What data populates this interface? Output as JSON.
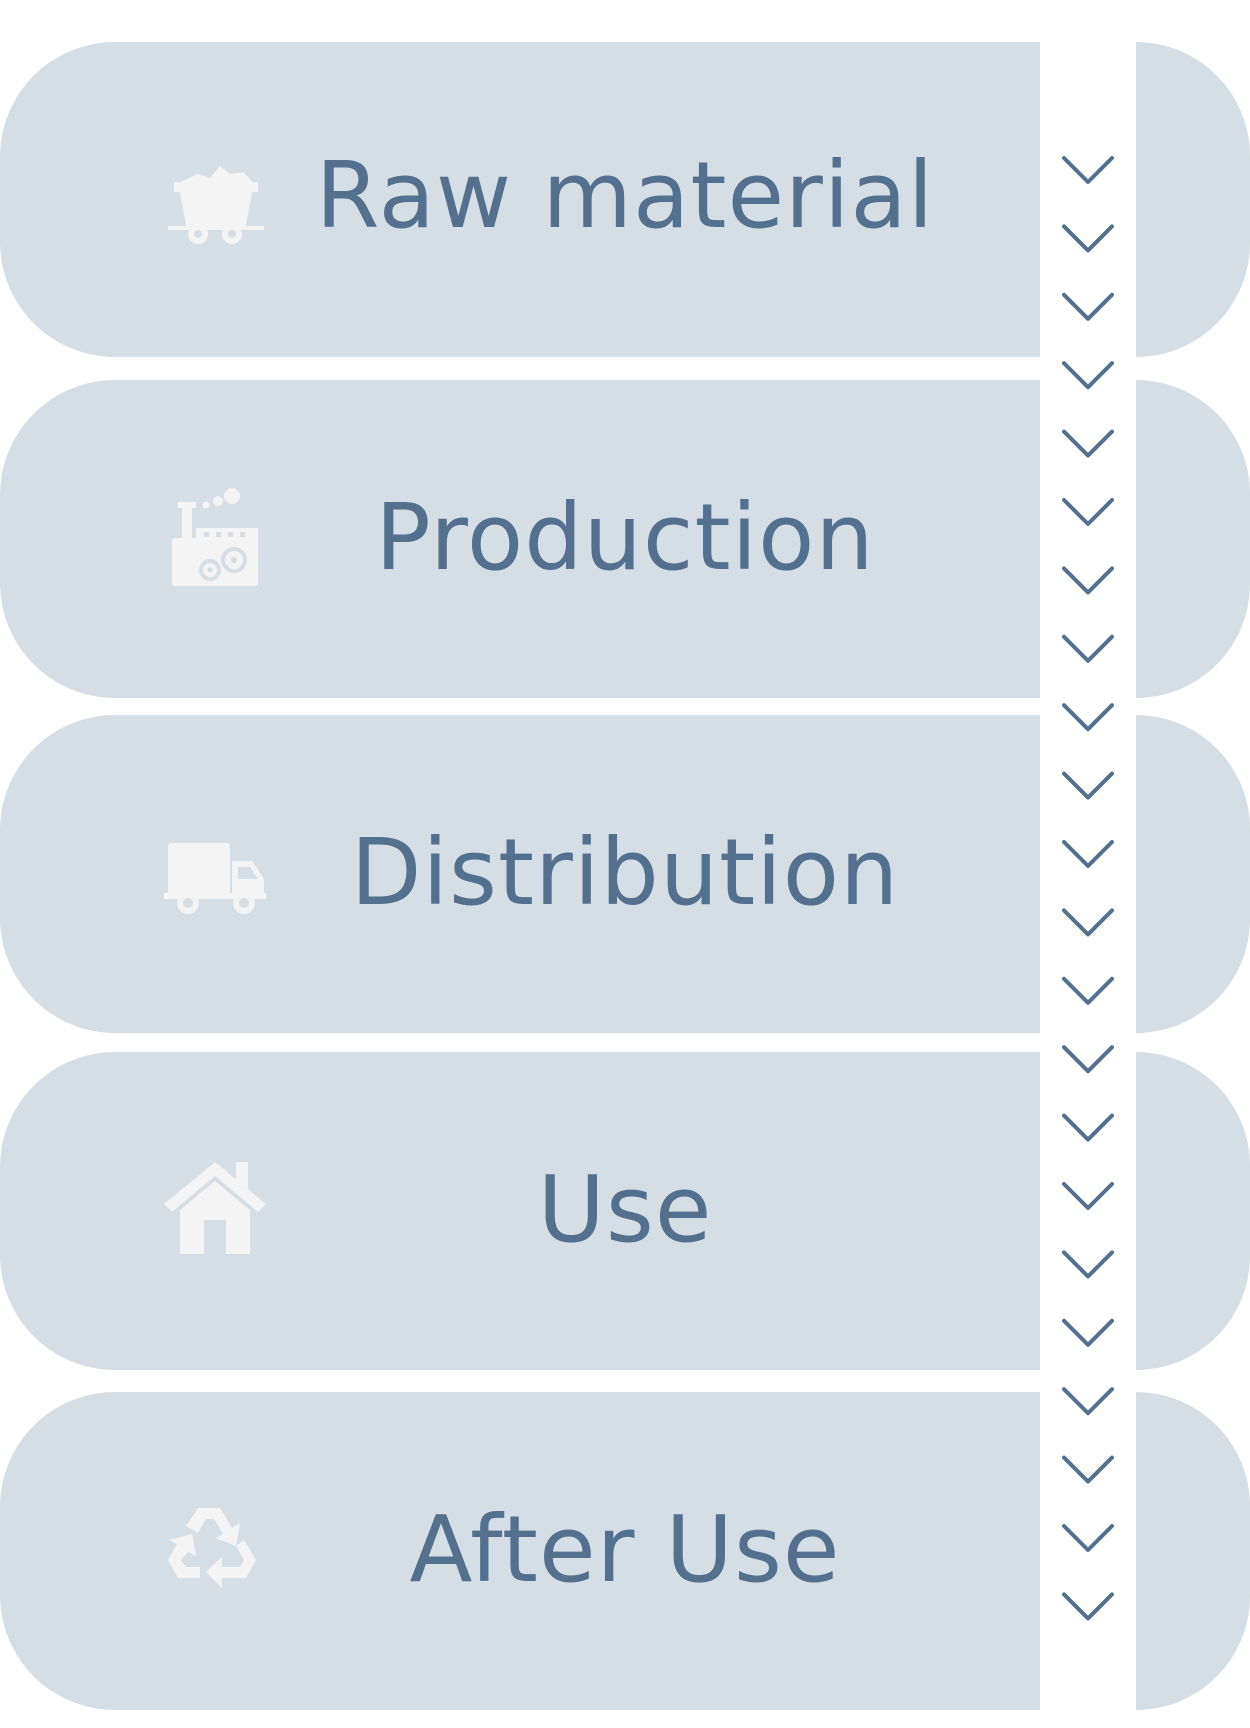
{
  "colors": {
    "card": "#d6dee5",
    "text": "#53708f",
    "icon": "#f4f4f4",
    "chevron": "#53708f",
    "background": "#ffffff"
  },
  "stages": [
    {
      "label": "Raw material",
      "icon": "mine-cart-icon"
    },
    {
      "label": "Production",
      "icon": "factory-icon"
    },
    {
      "label": "Distribution",
      "icon": "delivery-truck-icon"
    },
    {
      "label": "Use",
      "icon": "house-icon"
    },
    {
      "label": "After Use",
      "icon": "recycle-icon"
    }
  ],
  "flow_indicator": {
    "icon": "chevron-down-icon",
    "count": 22
  }
}
